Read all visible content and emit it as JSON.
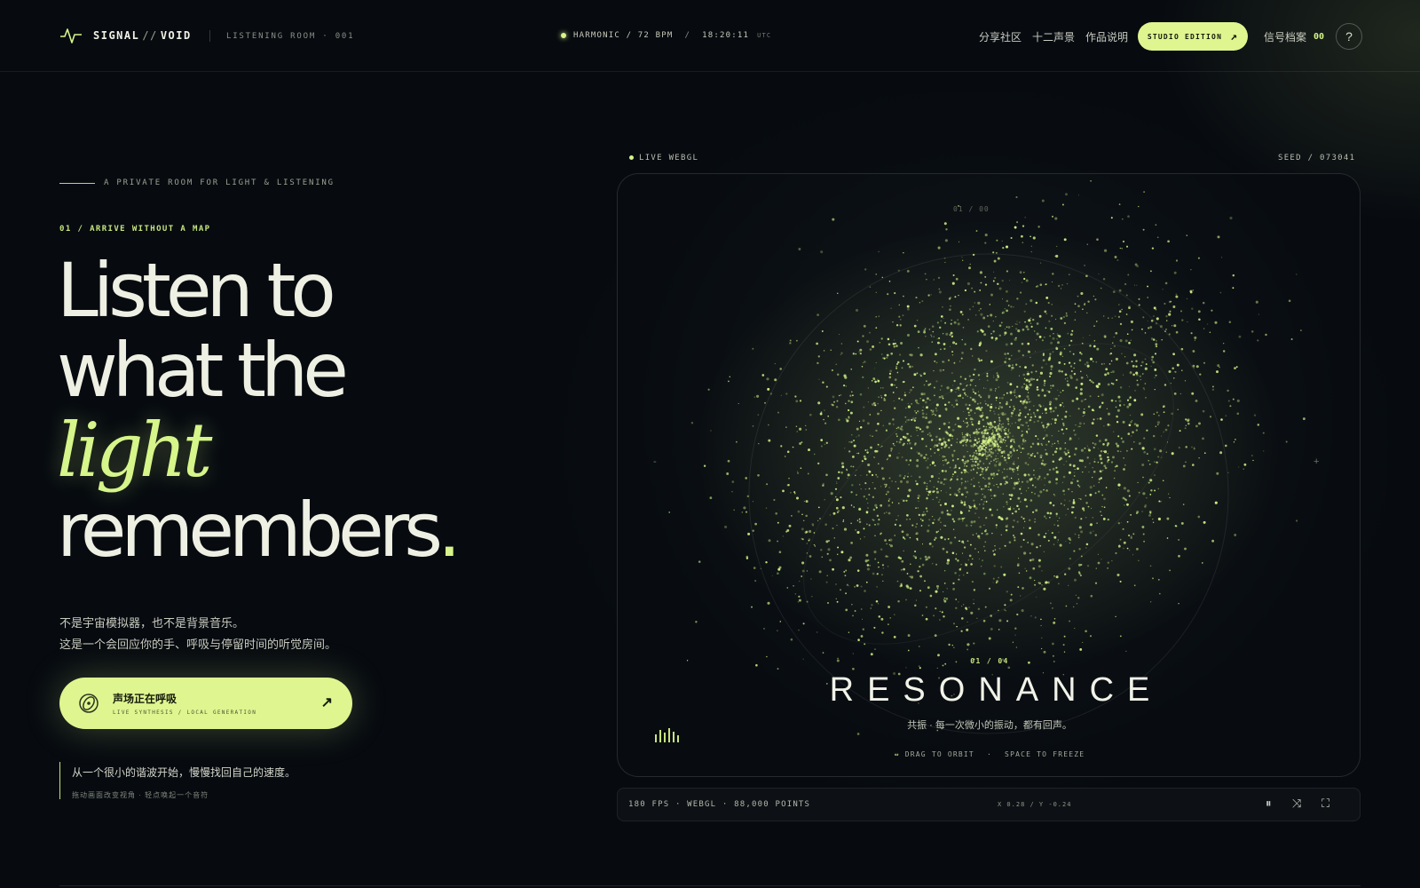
{
  "header": {
    "brand_left": "SIGNAL",
    "brand_sep": "//",
    "brand_right": "VOID",
    "room": "LISTENING ROOM · 001",
    "status": {
      "mode": "HARMONIC / 72 BPM",
      "sep": "/",
      "time": "18:20:11",
      "tz": "UTC"
    },
    "nav": [
      "分享社区",
      "十二声景",
      "作品说明"
    ],
    "studio_button": "STUDIO EDITION",
    "studio_arrow": "↗",
    "archive_label": "信号档案",
    "archive_count": "00",
    "help": "?"
  },
  "hero": {
    "tagline": "A PRIVATE ROOM FOR LIGHT & LISTENING",
    "section": "01 / ARRIVE WITHOUT A MAP",
    "headline": {
      "line1": "Listen to",
      "line2": "what the",
      "accent": "light",
      "line4": "remembers",
      "period": "."
    },
    "intro": [
      "不是宇宙模拟器，也不是背景音乐。",
      "这是一个会回应你的手、呼吸与停留时间的听觉房间。"
    ],
    "cta": {
      "title": "声场正在呼吸",
      "subtitle": "LIVE SYNTHESIS / LOCAL GENERATION",
      "arrow": "↗"
    },
    "quote": {
      "main": "从一个很小的谐波开始，慢慢找回自己的速度。",
      "hint": "拖动画面改变视角 · 轻点唤起一个音符"
    }
  },
  "visual": {
    "live_label": "LIVE WEBGL",
    "seed": "SEED / 073041",
    "ring_label": "01 / 00",
    "counter": "01 / 04",
    "title": "RESONANCE",
    "subtitle": "共振 · 每一次微小的振动，都有回声。",
    "hint_drag": "DRAG TO ORBIT",
    "hint_sep": "·",
    "hint_space": "SPACE TO FREEZE",
    "accent_color": "#d6f58a"
  },
  "footbar": {
    "stats": "180 FPS · WEBGL · 88,000 POINTS",
    "coords": "X 0.28 / Y -0.24",
    "pause": "⏸",
    "shuffle": "⤨",
    "fullscreen": "⛶"
  }
}
